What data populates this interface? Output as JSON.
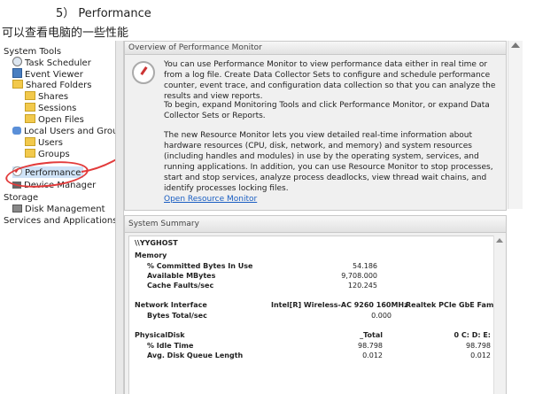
{
  "doc": {
    "heading": "5） Performance",
    "caption": "可以查看电脑的一些性能"
  },
  "tree": {
    "items": [
      {
        "label": "System Tools"
      },
      {
        "label": "Task Scheduler"
      },
      {
        "label": "Event Viewer"
      },
      {
        "label": "Shared Folders"
      },
      {
        "label": "Shares"
      },
      {
        "label": "Sessions"
      },
      {
        "label": "Open Files"
      },
      {
        "label": "Local Users and Groups"
      },
      {
        "label": "Users"
      },
      {
        "label": "Groups"
      },
      {
        "label": "Performance"
      },
      {
        "label": "Device Manager"
      },
      {
        "label": "Storage"
      },
      {
        "label": "Disk Management"
      },
      {
        "label": "Services and Applications"
      }
    ]
  },
  "overview": {
    "header": "Overview of Performance Monitor",
    "p1": "You can use Performance Monitor to view performance data either in real time or from a log file. Create Data Collector Sets to configure and schedule performance counter, event trace, and configuration data collection so that you can analyze the results and view reports.",
    "p2": "To begin, expand Monitoring Tools and click Performance Monitor, or expand Data Collector Sets or Reports.",
    "p3": "The new Resource Monitor lets you view detailed real-time information about hardware resources (CPU, disk, network, and memory) and system resources (including handles and modules) in use by the operating system, services, and running applications. In addition, you can use Resource Monitor to stop processes, start and stop services, analyze process deadlocks, view thread wait chains, and identify processes locking files.",
    "link": "Open Resource Monitor"
  },
  "summary": {
    "header": "System Summary",
    "host": "\\\\YYGHOST",
    "memory": {
      "title": "Memory",
      "rows": [
        {
          "label": "% Committed Bytes In Use",
          "value": "54.186"
        },
        {
          "label": "Available MBytes",
          "value": "9,708.000"
        },
        {
          "label": "Cache Faults/sec",
          "value": "120.245"
        }
      ]
    },
    "network": {
      "title": "Network Interface",
      "col1": "Intel[R] Wireless-AC 9260 160MHz",
      "col2": "Realtek PCIe GbE Fami",
      "rows": [
        {
          "label": "Bytes Total/sec",
          "value": "0.000"
        }
      ]
    },
    "disk": {
      "title": "PhysicalDisk",
      "col1": "_Total",
      "col2": "0 C: D: E:",
      "rows": [
        {
          "label": "% Idle Time",
          "v1": "98.798",
          "v2": "98.798"
        },
        {
          "label": "Avg. Disk Queue Length",
          "v1": "0.012",
          "v2": "0.012"
        }
      ]
    }
  }
}
